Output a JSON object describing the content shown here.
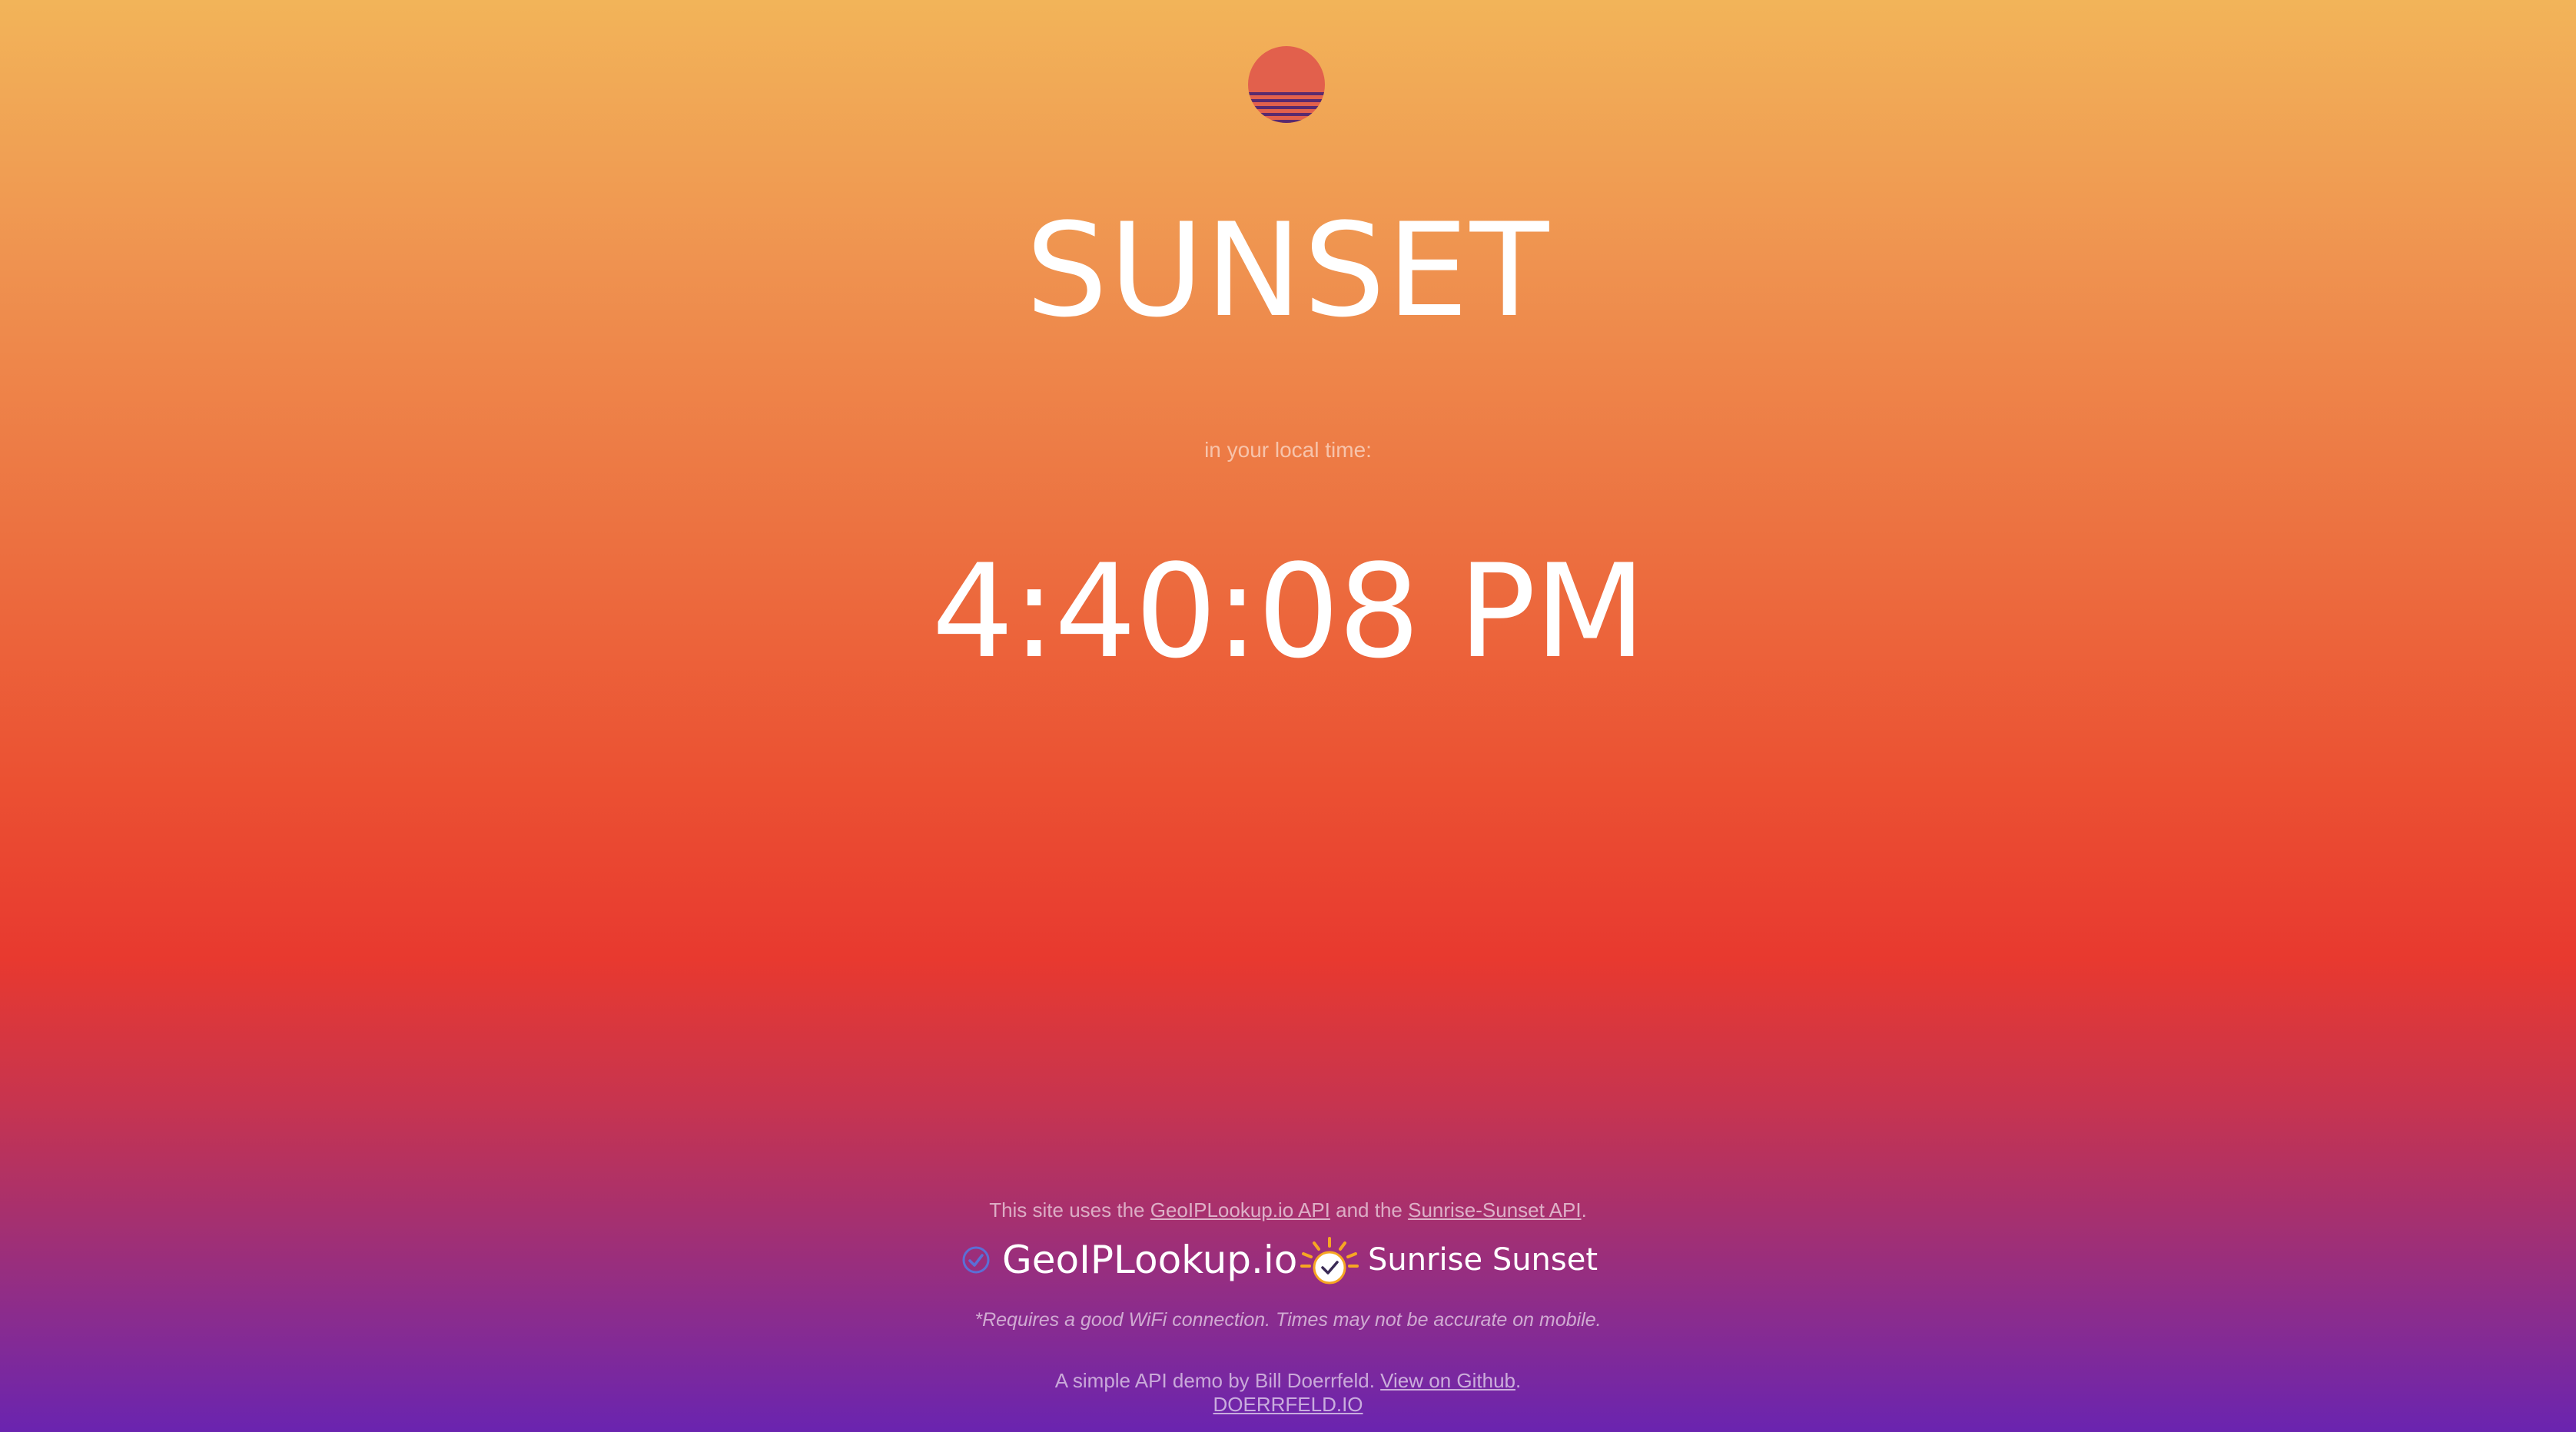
{
  "page": {
    "title": "SUNSET",
    "subtitle": "in your local time:",
    "time": "4:40:08 PM"
  },
  "credits": {
    "prefix": "This site uses the ",
    "geo_link": "GeoIPLookup.io API",
    "middle": " and the ",
    "sun_link": "Sunrise-Sunset API",
    "suffix": "."
  },
  "logos": {
    "geo_name": "GeoIPLookup.io",
    "sun_name": "Sunrise Sunset"
  },
  "note": "*Requires a good WiFi connection. Times may not be accurate on mobile.",
  "footer": {
    "prefix": "A simple API demo by Bill Doerrfeld. ",
    "github_link": "View on Github",
    "suffix": ".",
    "site_link": "DOERRFELD.IO"
  },
  "colors": {
    "sun_fill": "#e2604c",
    "sun_stripes": "#5a2a6e",
    "geo_icon": "#5b6fd6",
    "sun_rays": "#f6a623"
  }
}
